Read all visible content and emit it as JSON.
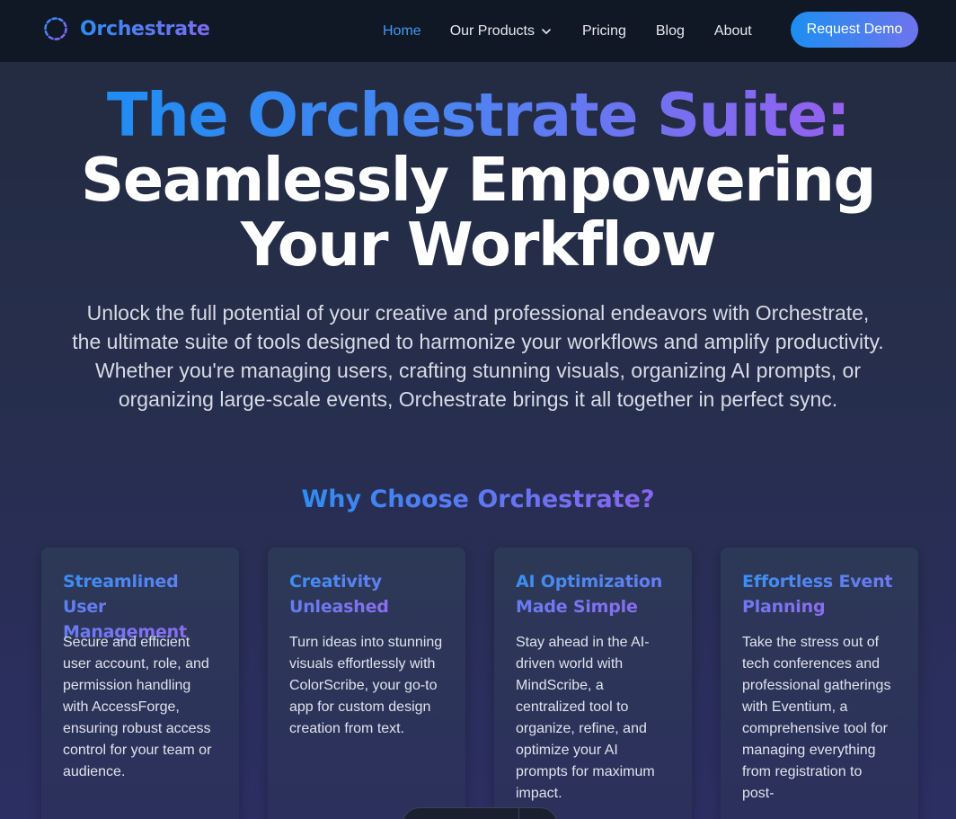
{
  "brand": {
    "name": "Orchestrate",
    "logo_icon": "dashed-circle-icon"
  },
  "nav": {
    "items": [
      {
        "label": "Home",
        "active": true
      },
      {
        "label": "Our Products",
        "has_dropdown": true
      },
      {
        "label": "Pricing"
      },
      {
        "label": "Blog"
      },
      {
        "label": "About"
      }
    ],
    "cta": "Request Demo"
  },
  "hero": {
    "title_line1": "The Orchestrate Suite:",
    "title_line2": "Seamlessly Empowering",
    "title_line3": "Your Workflow",
    "subtitle": "Unlock the full potential of your creative and professional endeavors with Orchestrate, the ultimate suite of tools designed to harmonize your workflows and amplify productivity. Whether you're managing users, crafting stunning visuals, organizing AI prompts, or organizing large-scale events, Orchestrate brings it all together in perfect sync."
  },
  "why": {
    "title": "Why Choose Orchestrate?",
    "cards": [
      {
        "title": "Streamlined User Management",
        "text": "Secure and efficient user account, role, and permission handling with AccessForge, ensuring robust access control for your team or audience."
      },
      {
        "title": "Creativity Unleashed",
        "text": "Turn ideas into stunning visuals effortlessly with ColorScribe, your go-to app for custom design creation from text."
      },
      {
        "title": "AI Optimization Made Simple",
        "text": "Stay ahead in the AI-driven world with MindScribe, a centralized tool to organize, refine, and optimize your AI prompts for maximum impact."
      },
      {
        "title": "Effortless Event Planning",
        "text": "Take the stress out of tech conferences and professional gatherings with Eventium, a comprehensive tool for managing everything from registration to post-"
      }
    ]
  },
  "colors": {
    "nav_bg": "#101725",
    "accent_blue": "#1f8df2",
    "accent_purple": "#9660ef",
    "active_link": "#3b9bf5"
  }
}
